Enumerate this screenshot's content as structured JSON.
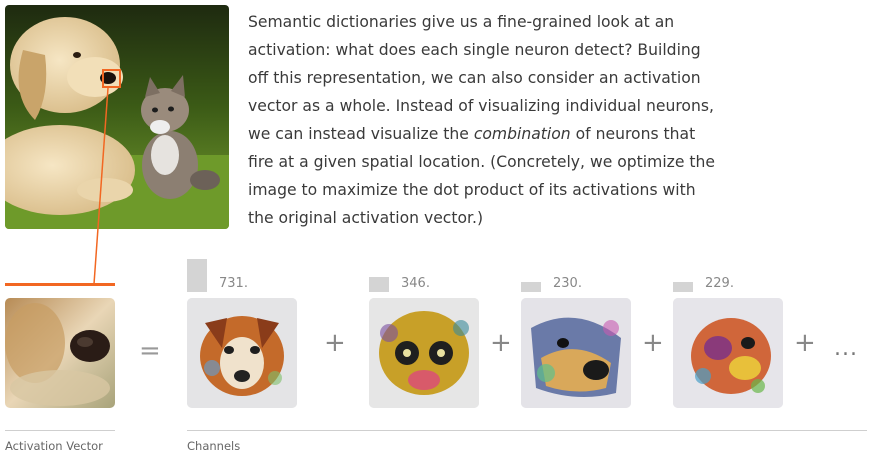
{
  "paragraph": {
    "part1": "Semantic dictionaries give us a fine-grained look at an activation: what does each single neuron detect? Building off this representation, we can also consider an activation vector as a whole. Instead of visualizing individual neurons, we can instead visualize the ",
    "emphasis": "combination",
    "part2": " of neurons that fire at a given spatial location. (Concretely, we optimize the image to maximize the dot product of its activations with the original activation vector.)"
  },
  "equation": {
    "equals": "=",
    "plus": "+",
    "ellipsis": "..."
  },
  "channels": [
    {
      "label": "731.",
      "magnitude": 1.0
    },
    {
      "label": "346.",
      "magnitude": 0.45
    },
    {
      "label": "230.",
      "magnitude": 0.3
    },
    {
      "label": "229.",
      "magnitude": 0.3
    }
  ],
  "captions": {
    "activation_vector": "Activation Vector",
    "channels": "Channels"
  },
  "colors": {
    "accent": "#f26722",
    "bar": "#d4d4d4"
  }
}
